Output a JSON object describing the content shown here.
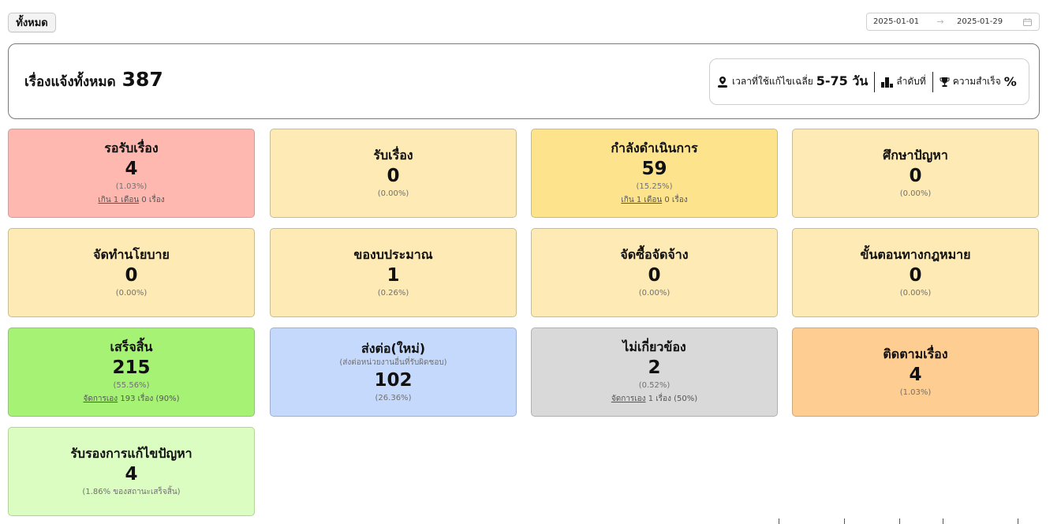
{
  "filter": {
    "label": "ทั้งหมด"
  },
  "date_range": {
    "start": "2025-01-01",
    "end": "2025-01-29",
    "separator": "→",
    "icon": "calendar-icon"
  },
  "summary": {
    "label": "เรื่องแจ้งทั้งหมด",
    "total": "387",
    "stats": {
      "avg_time_label": "เวลาที่ใช้แก้ไขเฉลี่ย",
      "avg_time_value": "5-75 วัน",
      "rank_label": "ลำดับที่",
      "success_label": "ความสำเร็จ",
      "success_value": "%"
    }
  },
  "cards": [
    {
      "title": "รอรับเรื่อง",
      "count": "4",
      "percent": "(1.03%)",
      "sub_link": "เกิน 1 เดือน",
      "sub_text": " 0 เรื่อง",
      "color": "#ffb8b0"
    },
    {
      "title": "รับเรื่อง",
      "count": "0",
      "percent": "(0.00%)",
      "color": "#feeab5"
    },
    {
      "title": "กำลังดำเนินการ",
      "count": "59",
      "percent": "(15.25%)",
      "sub_link": "เกิน 1 เดือน",
      "sub_text": " 0 เรื่อง",
      "color": "#fde48c"
    },
    {
      "title": "ศึกษาปัญหา",
      "count": "0",
      "percent": "(0.00%)",
      "color": "#feeab5"
    },
    {
      "title": "จัดทำนโยบาย",
      "count": "0",
      "percent": "(0.00%)",
      "color": "#feeab5"
    },
    {
      "title": "ของบประมาณ",
      "count": "1",
      "percent": "(0.26%)",
      "color": "#feeab5"
    },
    {
      "title": "จัดซื้อจัดจ้าง",
      "count": "0",
      "percent": "(0.00%)",
      "color": "#feeab5"
    },
    {
      "title": "ขั้นตอนทางกฎหมาย",
      "count": "0",
      "percent": "(0.00%)",
      "color": "#feeab5"
    },
    {
      "title": "เสร็จสิ้น",
      "count": "215",
      "percent": "(55.56%)",
      "sub_link": "จัดการเอง",
      "sub_text": " 193 เรื่อง (90%)",
      "color": "#a5f275"
    },
    {
      "title": "ส่งต่อ(ใหม่)",
      "subtitle": "(ส่งต่อหน่วยงานอื่นที่รับผิดชอบ)",
      "count": "102",
      "percent": "(26.36%)",
      "color": "#c5d9fd"
    },
    {
      "title": "ไม่เกี่ยวข้อง",
      "count": "2",
      "percent": "(0.52%)",
      "sub_link": "จัดการเอง",
      "sub_text": " 1 เรื่อง (50%)",
      "color": "#d9d9d9"
    },
    {
      "title": "ติดตามเรื่อง",
      "count": "4",
      "percent": "(1.03%)",
      "color": "#fdcd92"
    },
    {
      "title": "รับรองการแก้ไขปัญหา",
      "count": "4",
      "percent": "(1.86% ของสถานะเสร็จสิ้น)",
      "color": "#dcfdc2"
    }
  ]
}
